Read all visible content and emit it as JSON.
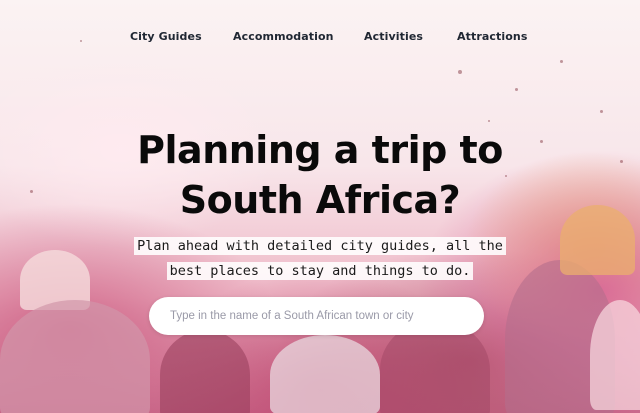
{
  "nav": {
    "items": [
      {
        "label": "City Guides"
      },
      {
        "label": "Accommodation"
      },
      {
        "label": "Activities"
      },
      {
        "label": "Attractions"
      }
    ]
  },
  "hero": {
    "title_line1": "Planning a trip to",
    "title_line2": "South Africa?",
    "subtitle_line1": "Plan ahead with detailed city guides, all the",
    "subtitle_line2": "best places to stay and things to do."
  },
  "search": {
    "placeholder": "Type in the name of a South African town or city",
    "value": ""
  },
  "colors": {
    "nav_text": "#202733",
    "headline": "#0a0a0a",
    "placeholder": "#9a9aa8"
  }
}
